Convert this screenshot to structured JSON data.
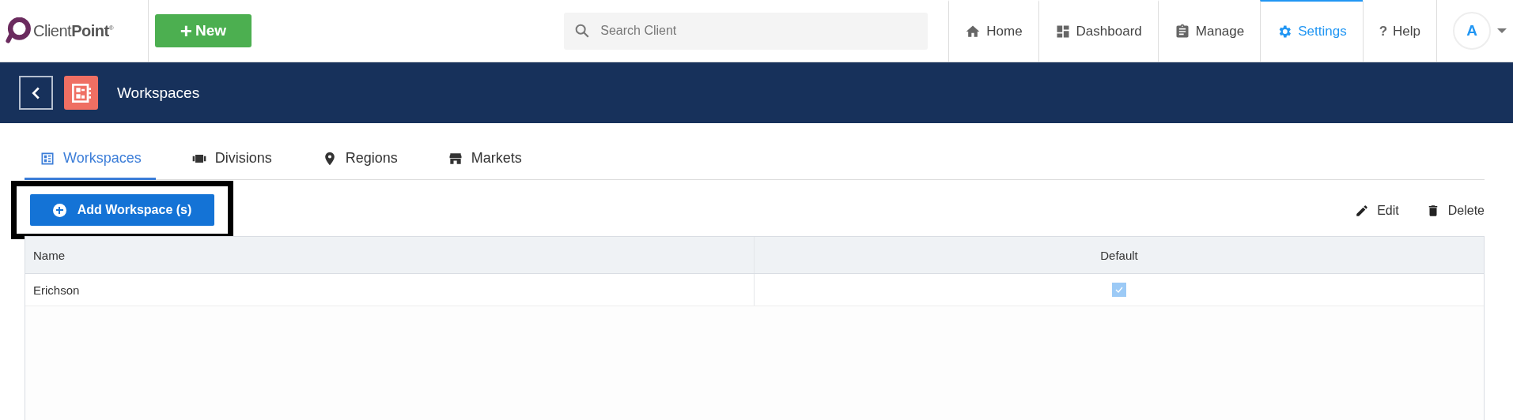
{
  "header": {
    "logo": {
      "name": "Client",
      "bold": "Point",
      "mark": "®"
    },
    "new_button": {
      "label": "New",
      "icon": "+"
    },
    "search": {
      "placeholder": "Search Client"
    },
    "nav": [
      {
        "label": "Home",
        "kind": "home",
        "selected": false
      },
      {
        "label": "Dashboard",
        "kind": "dashboard",
        "selected": false
      },
      {
        "label": "Manage",
        "kind": "clipboard",
        "selected": false
      },
      {
        "label": "Settings",
        "kind": "gear",
        "selected": true
      },
      {
        "label": "Help",
        "kind": "help",
        "icon": "?",
        "selected": false
      }
    ],
    "avatar": "A"
  },
  "title_bar": {
    "title": "Workspaces"
  },
  "tabs": [
    {
      "label": "Workspaces",
      "kind": "grid",
      "selected": true
    },
    {
      "label": "Divisions",
      "kind": "divisions",
      "selected": false
    },
    {
      "label": "Regions",
      "kind": "pin",
      "selected": false
    },
    {
      "label": "Markets",
      "kind": "store",
      "selected": false
    }
  ],
  "toolbar": {
    "add_button": {
      "label": "Add Workspace (s)",
      "highlighted": true
    },
    "actions": [
      {
        "label": "Edit",
        "kind": "pencil"
      },
      {
        "label": "Delete",
        "kind": "trash"
      }
    ]
  },
  "table": {
    "columns": [
      "Name",
      "Default"
    ],
    "rows": [
      {
        "name": "Erichson",
        "default": true
      }
    ]
  }
}
